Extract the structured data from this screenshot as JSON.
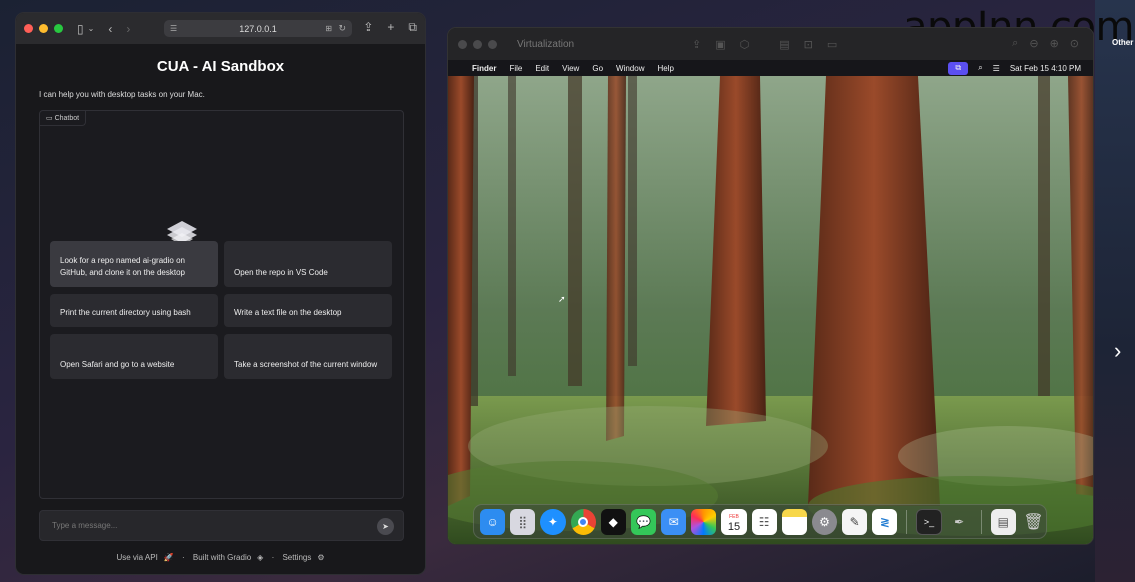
{
  "watermark": "appInn.com",
  "other_label": "Other",
  "safari": {
    "url": "127.0.0.1",
    "app": {
      "title": "CUA - AI Sandbox",
      "intro": "I can help you with desktop tasks on your Mac.",
      "chatbot_label": "Chatbot",
      "examples": [
        "Look for a repo named ai-gradio on GitHub, and clone it on the desktop",
        "Open the repo in VS Code",
        "Print the current directory using bash",
        "Write a text file on the desktop",
        "Open Safari and go to a website",
        "Take a screenshot of the current window"
      ],
      "message_placeholder": "Type a message...",
      "footer": {
        "api": "Use via API",
        "gradio": "Built with Gradio",
        "settings": "Settings",
        "sep": "·"
      }
    }
  },
  "vm": {
    "title": "Virtualization",
    "menubar": {
      "items": [
        "Finder",
        "File",
        "Edit",
        "View",
        "Go",
        "Window",
        "Help"
      ],
      "datetime": "Sat Feb 15  4:10 PM"
    },
    "dock": {
      "calendar_day": "15",
      "calendar_month": "FEB",
      "apps": [
        {
          "name": "finder",
          "color": "#2d8cf0"
        },
        {
          "name": "launchpad",
          "color": "#d8d8e0"
        },
        {
          "name": "safari",
          "color": "#1e90ff"
        },
        {
          "name": "chrome",
          "color": "#e9e9e9"
        },
        {
          "name": "unity",
          "color": "#111111"
        },
        {
          "name": "messages",
          "color": "#34c759"
        },
        {
          "name": "mail",
          "color": "#3b8ff5"
        },
        {
          "name": "photos",
          "color": "#ffffff"
        },
        {
          "name": "calendar",
          "color": "#ffffff"
        },
        {
          "name": "reminders",
          "color": "#ffffff"
        },
        {
          "name": "notes",
          "color": "#f7d74a"
        },
        {
          "name": "system-settings",
          "color": "#8a8a8f"
        },
        {
          "name": "textedit",
          "color": "#f5f5f5"
        },
        {
          "name": "vscode",
          "color": "#1f7ad1"
        }
      ]
    }
  }
}
